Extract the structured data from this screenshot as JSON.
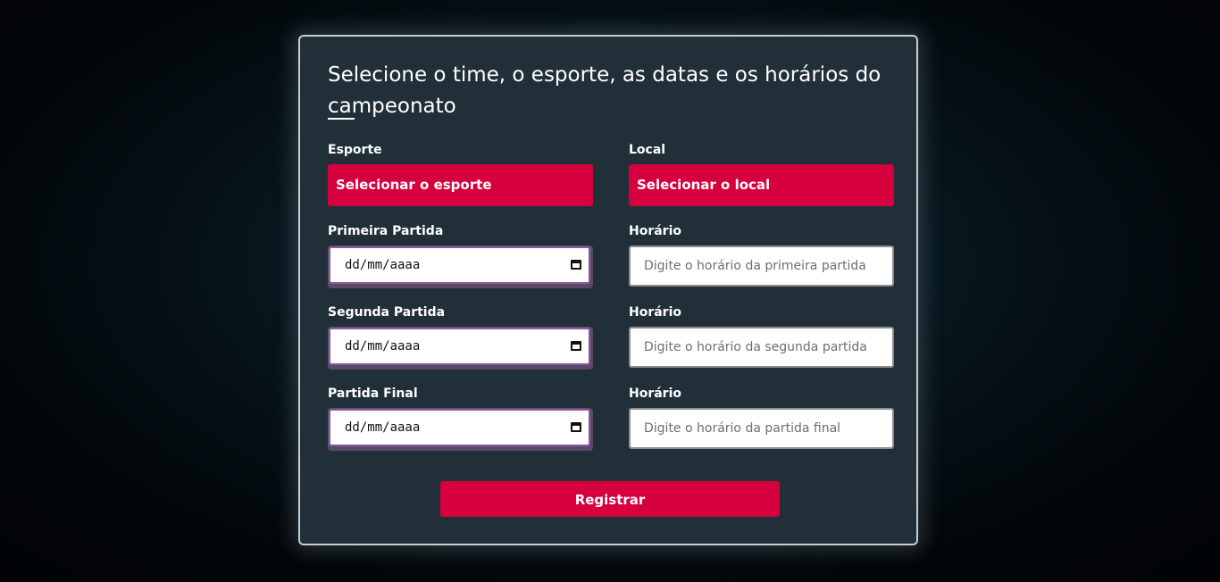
{
  "form": {
    "title": "Selecione o time, o esporte, as datas e os horários do campeonato",
    "esporte": {
      "label": "Esporte",
      "button": "Selecionar o esporte"
    },
    "local": {
      "label": "Local",
      "button": "Selecionar o local"
    },
    "rows": [
      {
        "date_label": "Primeira Partida",
        "date_value": "dd/mm/aaaa",
        "time_label": "Horário",
        "time_placeholder": "Digite o horário da primeira partida"
      },
      {
        "date_label": "Segunda Partida",
        "date_value": "dd/mm/aaaa",
        "time_label": "Horário",
        "time_placeholder": "Digite o horário da segunda partida"
      },
      {
        "date_label": "Partida Final",
        "date_value": "dd/mm/aaaa",
        "time_label": "Horário",
        "time_placeholder": "Digite o horário da partida final"
      }
    ],
    "submit_label": "Registrar"
  },
  "colors": {
    "accent": "#d6003f",
    "card_background": "#212f38",
    "page_background": "#050b0f"
  }
}
